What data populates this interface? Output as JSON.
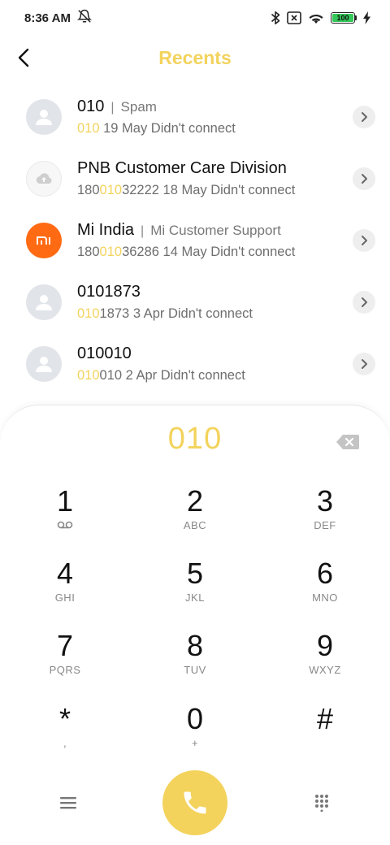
{
  "status_bar": {
    "time": "8:36 AM",
    "battery_level": "100",
    "icons": [
      "alarm-off-icon",
      "bluetooth-icon",
      "sim-off-icon",
      "wifi-icon",
      "battery-icon",
      "charging-icon"
    ]
  },
  "header": {
    "title": "Recents",
    "back_icon": "chevron-left-icon"
  },
  "colors": {
    "accent": "#f3d35c",
    "mi_brand": "#ff6a13",
    "avatar_grey": "#e1e4e9"
  },
  "recents": [
    {
      "title": "010",
      "tag": "Spam",
      "num_pre": "",
      "num_hl": "010",
      "num_post": "",
      "detail": " 19 May Didn't connect",
      "avatar": "person-icon"
    },
    {
      "title": "PNB Customer Care Division",
      "tag": "",
      "num_pre": "180",
      "num_hl": "010",
      "num_post": "32222",
      "detail": " 18 May Didn't connect",
      "avatar": "cloud-icon"
    },
    {
      "title": "Mi India",
      "tag": "Mi Customer Support",
      "num_pre": "180",
      "num_hl": "010",
      "num_post": "36286",
      "detail": " 14 May Didn't connect",
      "avatar": "mi-logo",
      "avatar_text": "mi"
    },
    {
      "title": "0101873",
      "tag": "",
      "num_pre": "",
      "num_hl": "010",
      "num_post": "1873",
      "detail": " 3 Apr Didn't connect",
      "avatar": "person-icon"
    },
    {
      "title": "010010",
      "tag": "",
      "num_pre": "",
      "num_hl": "010",
      "num_post": "010",
      "detail": " 2 Apr Didn't connect",
      "avatar": "person-icon"
    }
  ],
  "dialpad": {
    "display": "010",
    "keys": [
      {
        "digit": "1",
        "letters": ""
      },
      {
        "digit": "2",
        "letters": "ABC"
      },
      {
        "digit": "3",
        "letters": "DEF"
      },
      {
        "digit": "4",
        "letters": "GHI"
      },
      {
        "digit": "5",
        "letters": "JKL"
      },
      {
        "digit": "6",
        "letters": "MNO"
      },
      {
        "digit": "7",
        "letters": "PQRS"
      },
      {
        "digit": "8",
        "letters": "TUV"
      },
      {
        "digit": "9",
        "letters": "WXYZ"
      },
      {
        "digit": "*",
        "letters": ","
      },
      {
        "digit": "0",
        "letters": "+"
      },
      {
        "digit": "#",
        "letters": ""
      }
    ]
  }
}
